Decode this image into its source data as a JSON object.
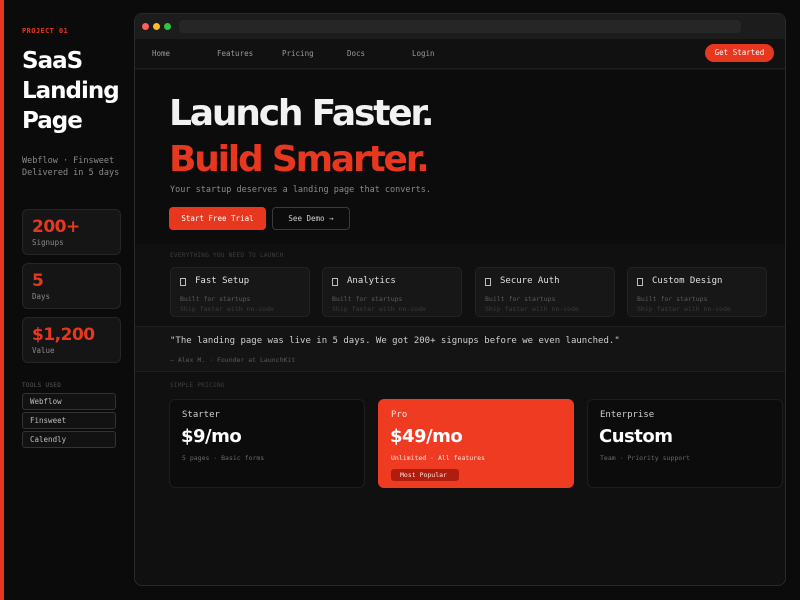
{
  "sidebar": {
    "project_label": "PROJECT 01",
    "title_lines": [
      "SaaS",
      "Landing",
      "Page"
    ],
    "meta_lines": [
      "Webflow · Finsweet",
      "Delivered in 5 days"
    ],
    "stats": [
      {
        "value": "200+",
        "label": "Signups"
      },
      {
        "value": "5",
        "label": "Days"
      },
      {
        "value": "$1,200",
        "label": "Value"
      }
    ],
    "tools_heading": "TOOLS USED",
    "tools": [
      "Webflow",
      "Finsweet",
      "Calendly"
    ]
  },
  "browser": {
    "nav": {
      "links": [
        "Home",
        "Features",
        "Pricing",
        "Docs",
        "Login"
      ],
      "cta": "Get Started"
    },
    "hero": {
      "line1": "Launch Faster.",
      "line2": "Build Smarter.",
      "subtitle": "Your startup deserves a landing page that converts.",
      "primary_cta": "Start Free Trial",
      "secondary_cta": "See Demo →"
    },
    "features": {
      "heading": "EVERYTHING YOU NEED TO LAUNCH",
      "items": [
        {
          "title": "Fast Setup",
          "desc1": "Built for startups",
          "desc2": "Ship faster with no-code"
        },
        {
          "title": "Analytics",
          "desc1": "Built for startups",
          "desc2": "Ship faster with no-code"
        },
        {
          "title": "Secure Auth",
          "desc1": "Built for startups",
          "desc2": "Ship faster with no-code"
        },
        {
          "title": "Custom Design",
          "desc1": "Built for startups",
          "desc2": "Ship faster with no-code"
        }
      ]
    },
    "testimonial": {
      "quote": "\"The landing page was live in 5 days. We got 200+ signups before we even launched.\"",
      "author": "— Alex M. · Founder at LaunchKit"
    },
    "pricing": {
      "heading": "SIMPLE PRICING",
      "plans": [
        {
          "name": "Starter",
          "price": "$9/mo",
          "features": "5 pages · Basic forms"
        },
        {
          "name": "Pro",
          "price": "$49/mo",
          "features": "Unlimited · All features",
          "badge": "Most Popular"
        },
        {
          "name": "Enterprise",
          "price": "Custom",
          "features": "Team · Priority support"
        }
      ]
    }
  },
  "colors": {
    "accent": "#e8371f",
    "background": "#0b0b0b",
    "dot_red": "#ff5f56",
    "dot_yellow": "#ffbd2e",
    "dot_green": "#27c93f"
  }
}
